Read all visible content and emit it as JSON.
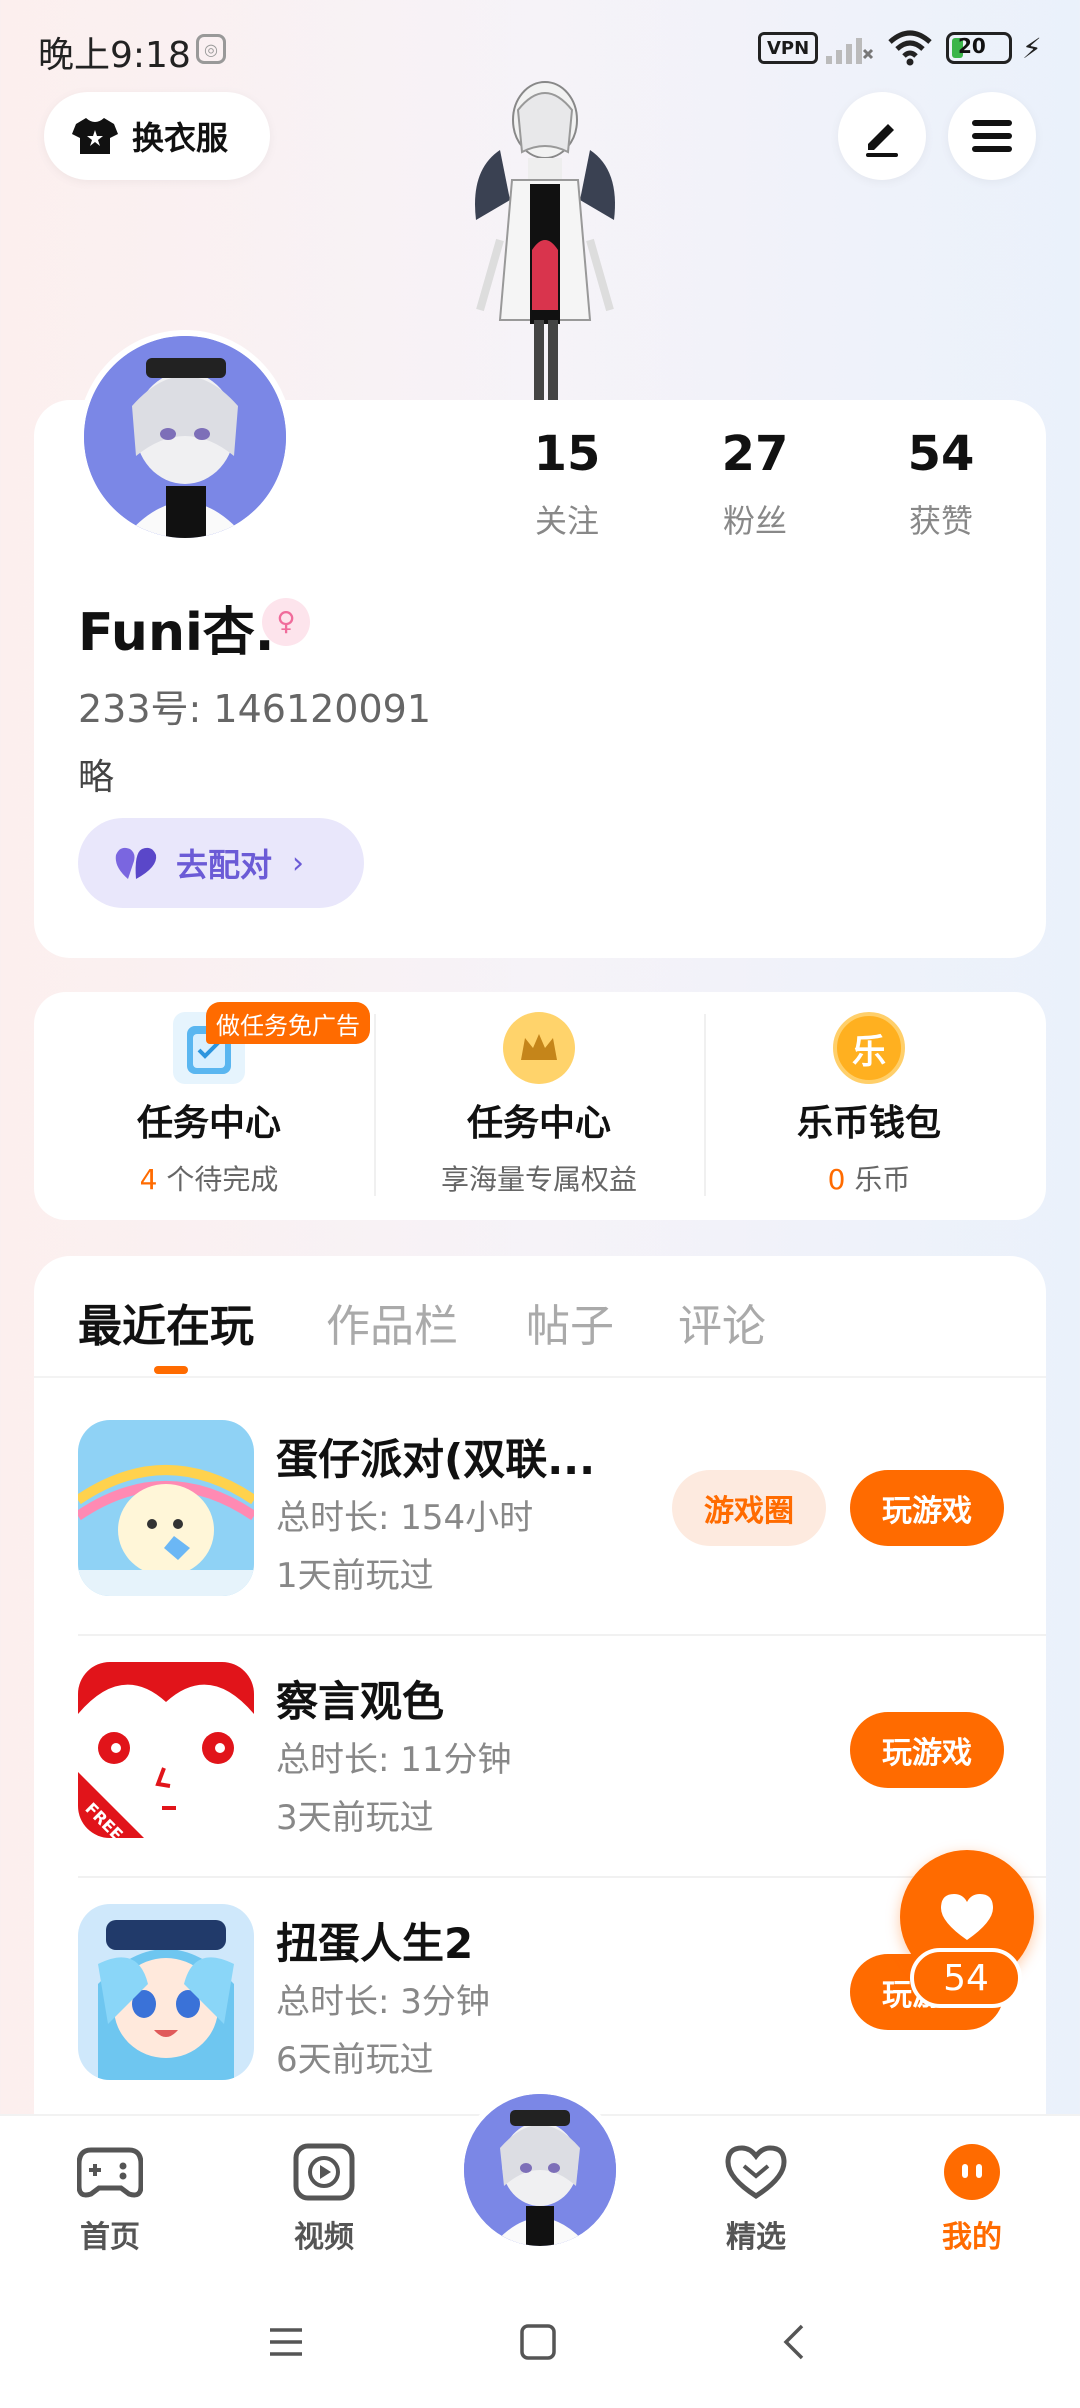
{
  "status": {
    "time": "晚上9:18",
    "vpn": "VPN",
    "battery": "20",
    "battery_level": 0.2
  },
  "topbar": {
    "outfit_label": "换衣服"
  },
  "profile": {
    "username": "Funi杏.",
    "gender_symbol": "♀",
    "id_text": "233号: 146120091",
    "bio": "略",
    "pair_label": "去配对",
    "pair_chevron": "›",
    "stats": [
      {
        "value": "15",
        "label": "关注"
      },
      {
        "value": "27",
        "label": "粉丝"
      },
      {
        "value": "54",
        "label": "获赞"
      }
    ]
  },
  "tasks": {
    "ad_badge": "做任务免广告",
    "items": [
      {
        "title": "任务中心",
        "count": "4",
        "suffix": " 个待完成"
      },
      {
        "title": "任务中心",
        "sub": "享海量专属权益"
      },
      {
        "title": "乐币钱包",
        "icon_char": "乐",
        "count": "0",
        "suffix": " 乐币"
      }
    ]
  },
  "tabs": [
    "最近在玩",
    "作品栏",
    "帖子",
    "评论"
  ],
  "games": [
    {
      "name": "蛋仔派对(双联...",
      "time": "总时长: 154小时",
      "last": "1天前玩过",
      "circle_label": "游戏圈",
      "play_label": "玩游戏"
    },
    {
      "name": "察言观色",
      "time": "总时长: 11分钟",
      "last": "3天前玩过",
      "play_label": "玩游戏",
      "free_tag": "FREE"
    },
    {
      "name": "扭蛋人生2",
      "time": "总时长: 3分钟",
      "last": "6天前玩过",
      "play_label": "玩游戏"
    }
  ],
  "float_like_count": "54",
  "nav": [
    {
      "label": "首页",
      "icon": "gamepad-icon"
    },
    {
      "label": "视频",
      "icon": "video-icon"
    },
    {
      "label": "精选",
      "icon": "heart-gem-icon"
    },
    {
      "label": "我的",
      "icon": "face-icon"
    }
  ],
  "colors": {
    "accent": "#ff6b00",
    "pair_text": "#6b5bd6",
    "pair_bg": "#e9e7fb"
  }
}
